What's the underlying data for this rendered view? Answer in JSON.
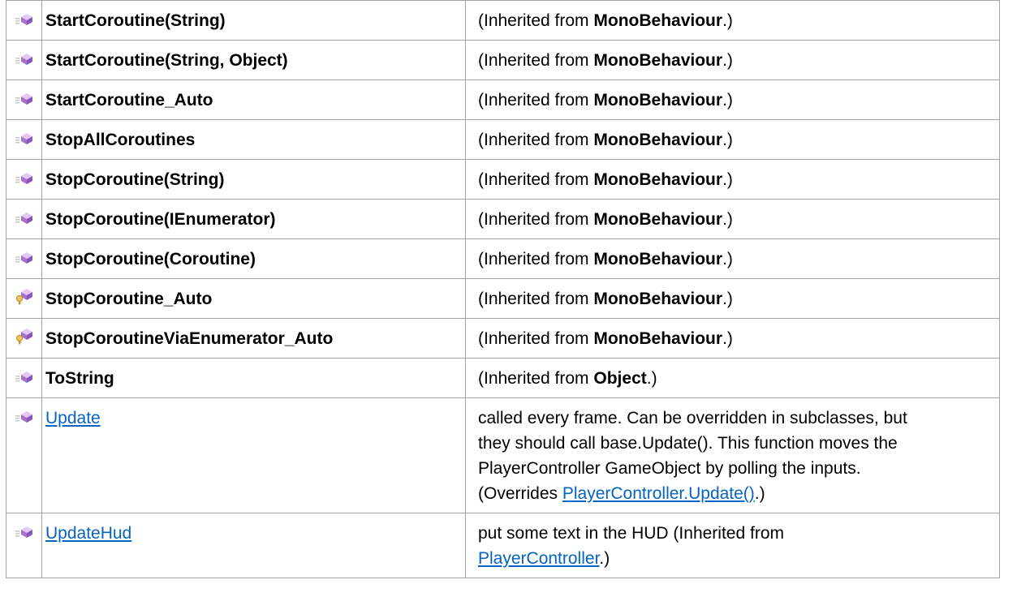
{
  "inherited_prefix": "(Inherited from ",
  "inherited_suffix": ".)",
  "rows": [
    {
      "icon": "public-method-icon",
      "name": "StartCoroutine(String)",
      "inherited": "MonoBehaviour"
    },
    {
      "icon": "public-method-icon",
      "name": "StartCoroutine(String, Object)",
      "inherited": "MonoBehaviour"
    },
    {
      "icon": "public-method-icon",
      "name": "StartCoroutine_Auto",
      "inherited": "MonoBehaviour"
    },
    {
      "icon": "public-method-icon",
      "name": "StopAllCoroutines",
      "inherited": "MonoBehaviour"
    },
    {
      "icon": "public-method-icon",
      "name": "StopCoroutine(String)",
      "inherited": "MonoBehaviour"
    },
    {
      "icon": "public-method-icon",
      "name": "StopCoroutine(IEnumerator)",
      "inherited": "MonoBehaviour"
    },
    {
      "icon": "public-method-icon",
      "name": "StopCoroutine(Coroutine)",
      "inherited": "MonoBehaviour"
    },
    {
      "icon": "protected-method-icon",
      "name": "StopCoroutine_Auto",
      "inherited": "MonoBehaviour"
    },
    {
      "icon": "protected-method-icon",
      "name": "StopCoroutineViaEnumerator_Auto",
      "inherited": "MonoBehaviour"
    },
    {
      "icon": "public-method-icon",
      "name": "ToString",
      "inherited": "Object"
    }
  ],
  "update_row": {
    "name": "Update",
    "desc_lines": [
      "called every frame. Can be overridden in subclasses, but",
      "they should call base.Update(). This function moves the",
      "PlayerController GameObject by polling the inputs."
    ],
    "overrides_prefix": "(Overrides ",
    "overrides_link": "PlayerController.Update()",
    "overrides_suffix": ".)"
  },
  "updatehud_row": {
    "name": "UpdateHud",
    "desc_line": "put some text in the HUD (Inherited from",
    "link": "PlayerController",
    "suffix": ".)"
  },
  "colors": {
    "link": "#0563c1",
    "border": "#a3a3a3",
    "method_icon": "#b58bd6"
  }
}
